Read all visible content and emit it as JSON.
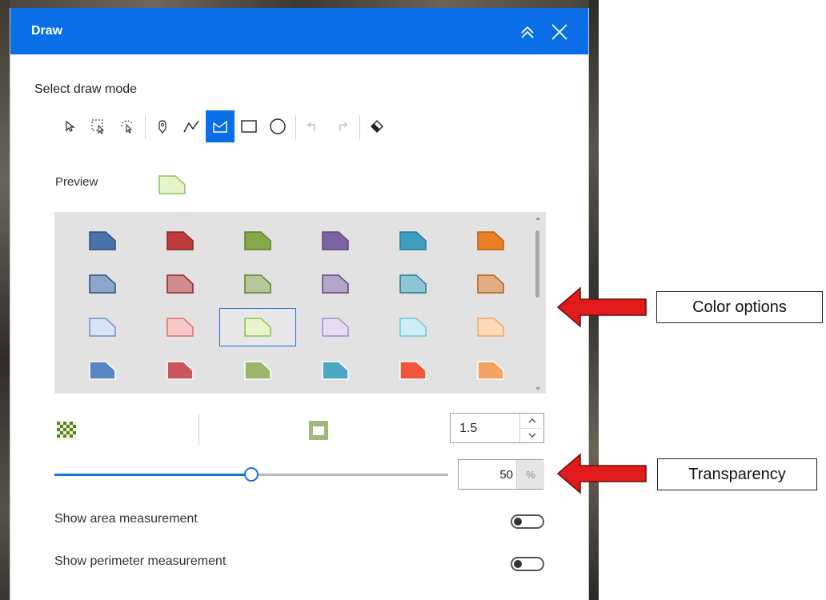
{
  "panel": {
    "title": "Draw",
    "mode_label": "Select draw mode",
    "tools": [
      {
        "name": "select-tool",
        "icon": "cursor-arrow-icon",
        "active": false,
        "disabled": false
      },
      {
        "name": "rectangle-select-tool",
        "icon": "rect-select-icon",
        "active": false,
        "disabled": false
      },
      {
        "name": "lasso-select-tool",
        "icon": "lasso-select-icon",
        "active": false,
        "disabled": false
      },
      {
        "name": "point-tool",
        "icon": "pin-icon",
        "active": false,
        "disabled": false
      },
      {
        "name": "polyline-tool",
        "icon": "polyline-icon",
        "active": false,
        "disabled": false
      },
      {
        "name": "polygon-tool",
        "icon": "polygon-icon",
        "active": true,
        "disabled": false
      },
      {
        "name": "rectangle-tool",
        "icon": "rectangle-icon",
        "active": false,
        "disabled": false
      },
      {
        "name": "circle-tool",
        "icon": "circle-icon",
        "active": false,
        "disabled": false
      },
      {
        "name": "undo-tool",
        "icon": "undo-icon",
        "active": false,
        "disabled": true
      },
      {
        "name": "redo-tool",
        "icon": "redo-icon",
        "active": false,
        "disabled": true
      },
      {
        "name": "erase-tool",
        "icon": "eraser-icon",
        "active": false,
        "disabled": false
      }
    ],
    "preview_label": "Preview",
    "preview_fill": "#e6f5c9",
    "preview_stroke": "#8fbf5a",
    "palette": [
      [
        {
          "fill": "#4a72a8",
          "stroke": "#2d4f80"
        },
        {
          "fill": "#bf3a3a",
          "stroke": "#8c2424"
        },
        {
          "fill": "#86a847",
          "stroke": "#5e7d2c"
        },
        {
          "fill": "#7e63a3",
          "stroke": "#5a4480"
        },
        {
          "fill": "#3d9fbf",
          "stroke": "#2a7a96"
        },
        {
          "fill": "#ec7e24",
          "stroke": "#b85e12"
        }
      ],
      [
        {
          "fill": "#8aa6c9",
          "stroke": "#2d4f80"
        },
        {
          "fill": "#cf8c8c",
          "stroke": "#8c2424"
        },
        {
          "fill": "#b7c99b",
          "stroke": "#5e7d2c"
        },
        {
          "fill": "#b3a6c6",
          "stroke": "#5a4480"
        },
        {
          "fill": "#8ec4d3",
          "stroke": "#2a7a96"
        },
        {
          "fill": "#e0ae83",
          "stroke": "#b85e12"
        }
      ],
      [
        {
          "fill": "#d9e3f5",
          "stroke": "#6e93c9"
        },
        {
          "fill": "#f7c9c9",
          "stroke": "#e06c6c"
        },
        {
          "fill": "#e6f5c9",
          "stroke": "#8fbf5a"
        },
        {
          "fill": "#e5dcf2",
          "stroke": "#a48fcf"
        },
        {
          "fill": "#cfeff7",
          "stroke": "#6cc6dd"
        },
        {
          "fill": "#fcd9b8",
          "stroke": "#f2a463"
        }
      ],
      [
        {
          "fill": "#5b86c4",
          "stroke": "#ffffff"
        },
        {
          "fill": "#c9565c",
          "stroke": "#ffffff"
        },
        {
          "fill": "#9bb56a",
          "stroke": "#ffffff"
        },
        {
          "fill": "#4aa8c2",
          "stroke": "#ffffff"
        },
        {
          "fill": "#f2553b",
          "stroke": "#ffffff"
        },
        {
          "fill": "#f4a261",
          "stroke": "#ffffff"
        }
      ]
    ],
    "selected_swatch": [
      2,
      2
    ],
    "outline_width": "1.5",
    "transparency_value": "50",
    "transparency_unit": "%",
    "transparency_fraction": 0.5,
    "toggles": [
      {
        "label": "Show area measurement",
        "on": false
      },
      {
        "label": "Show perimeter measurement",
        "on": false
      }
    ],
    "accent": "#0a6ee6"
  },
  "callouts": [
    {
      "label": "Color options"
    },
    {
      "label": "Transparency"
    }
  ],
  "callout_arrow_color": "#e11b1b"
}
